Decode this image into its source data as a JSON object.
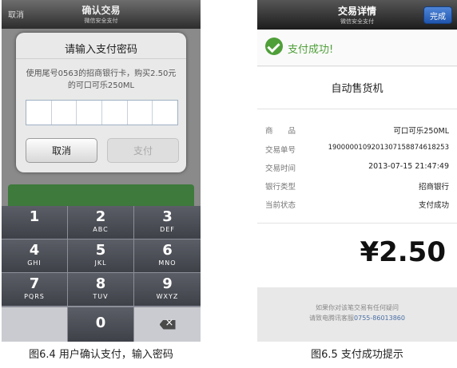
{
  "left": {
    "nav": {
      "cancel": "取消",
      "title": "确认交易",
      "subtitle": "微信安全支付"
    },
    "dialog": {
      "title": "请输入支付密码",
      "message": "使用尾号0563的招商银行卡，购买2.50元的可口可乐250ML",
      "cancel_label": "取消",
      "pay_label": "支付",
      "pin_cells": 6
    },
    "keypad": [
      {
        "num": "1",
        "letters": ""
      },
      {
        "num": "2",
        "letters": "ABC"
      },
      {
        "num": "3",
        "letters": "DEF"
      },
      {
        "num": "4",
        "letters": "GHI"
      },
      {
        "num": "5",
        "letters": "JKL"
      },
      {
        "num": "6",
        "letters": "MNO"
      },
      {
        "num": "7",
        "letters": "PQRS"
      },
      {
        "num": "8",
        "letters": "TUV"
      },
      {
        "num": "9",
        "letters": "WXYZ"
      },
      {
        "num": "0",
        "letters": ""
      }
    ],
    "caption": "图6.4 用户确认支付，输入密码"
  },
  "right": {
    "nav": {
      "title": "交易详情",
      "subtitle": "微信安全支付",
      "done": "完成"
    },
    "success": "支付成功!",
    "merchant": "自动售货机",
    "details": [
      {
        "k": "商　　品",
        "v": "可口可乐250ML"
      },
      {
        "k": "交易单号",
        "v": "1900000109201307158874618253"
      },
      {
        "k": "交易时间",
        "v": "2013-07-15 21:47:49"
      },
      {
        "k": "银行类型",
        "v": "招商银行"
      },
      {
        "k": "当前状态",
        "v": "支付成功"
      }
    ],
    "amount": "¥2.50",
    "footer_line1": "如果你对该笔交易有任何疑问",
    "footer_line2_prefix": "请致电腾讯客服",
    "footer_phone": "0755-86013860",
    "caption": "图6.5 支付成功提示"
  },
  "colors": {
    "success_green": "#4f9f39",
    "done_blue": "#2f68c0"
  }
}
